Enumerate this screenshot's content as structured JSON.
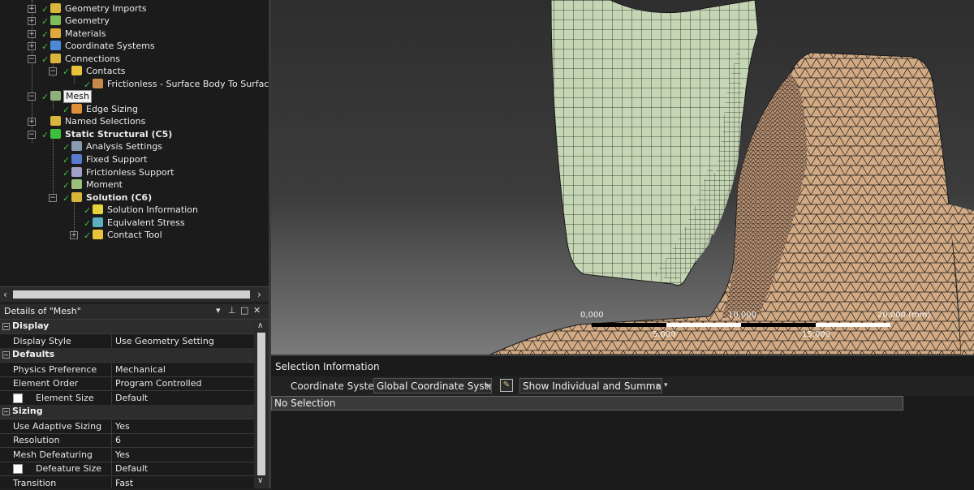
{
  "tree": {
    "items": [
      {
        "label": "Geometry Imports",
        "icon": "geometry-imports-icon"
      },
      {
        "label": "Geometry",
        "icon": "geometry-icon"
      },
      {
        "label": "Materials",
        "icon": "materials-icon"
      },
      {
        "label": "Coordinate Systems",
        "icon": "coordinate-systems-icon"
      },
      {
        "label": "Connections",
        "icon": "connections-icon"
      },
      {
        "label": "Contacts",
        "icon": "contacts-icon"
      },
      {
        "label": "Frictionless - Surface Body To Surface Bod",
        "icon": "contact-region-icon"
      },
      {
        "label": "Mesh",
        "icon": "mesh-icon"
      },
      {
        "label": "Edge Sizing",
        "icon": "edge-sizing-icon"
      },
      {
        "label": "Named Selections",
        "icon": "named-selections-icon"
      },
      {
        "label": "Static Structural (C5)",
        "icon": "static-structural-icon"
      },
      {
        "label": "Analysis Settings",
        "icon": "analysis-settings-icon"
      },
      {
        "label": "Fixed Support",
        "icon": "fixed-support-icon"
      },
      {
        "label": "Frictionless Support",
        "icon": "frictionless-support-icon"
      },
      {
        "label": "Moment",
        "icon": "moment-icon"
      },
      {
        "label": "Solution (C6)",
        "icon": "solution-icon"
      },
      {
        "label": "Solution Information",
        "icon": "solution-information-icon"
      },
      {
        "label": "Equivalent Stress",
        "icon": "equivalent-stress-icon"
      },
      {
        "label": "Contact Tool",
        "icon": "contact-tool-icon"
      }
    ]
  },
  "details": {
    "title": "Details of \"Mesh\"",
    "controls": {
      "dropdown": "▾",
      "pin": "⊥",
      "maximize": "□",
      "close": "✕"
    },
    "groups": {
      "display": "Display",
      "defaults": "Defaults",
      "sizing": "Sizing"
    },
    "rows": {
      "display_style": {
        "name": "Display Style",
        "value": "Use Geometry Setting"
      },
      "physics_preference": {
        "name": "Physics Preference",
        "value": "Mechanical"
      },
      "element_order": {
        "name": "Element Order",
        "value": "Program Controlled"
      },
      "element_size": {
        "name": "Element Size",
        "value": "Default"
      },
      "use_adaptive_sizing": {
        "name": "Use Adaptive Sizing",
        "value": "Yes"
      },
      "resolution": {
        "name": "Resolution",
        "value": "6"
      },
      "mesh_defeaturing": {
        "name": "Mesh Defeaturing",
        "value": "Yes"
      },
      "defeature_size": {
        "name": "Defeature Size",
        "value": "Default"
      },
      "transition": {
        "name": "Transition",
        "value": "Fast"
      }
    }
  },
  "viewport": {
    "scale": {
      "top_labels": [
        "0,000",
        "10,000",
        "20,000 (mm)"
      ],
      "bottom_labels": [
        "5,000",
        "15,000"
      ]
    },
    "colors": {
      "green_body": "#c5d6b5",
      "tan_body": "#d2aa84",
      "mesh_line": "#1a1a1a"
    }
  },
  "selection": {
    "title": "Selection Information",
    "coord_label": "Coordinate System:",
    "coord_value": "Global Coordinate System",
    "show_value": "Show Individual and Summary",
    "no_selection": "No Selection"
  }
}
